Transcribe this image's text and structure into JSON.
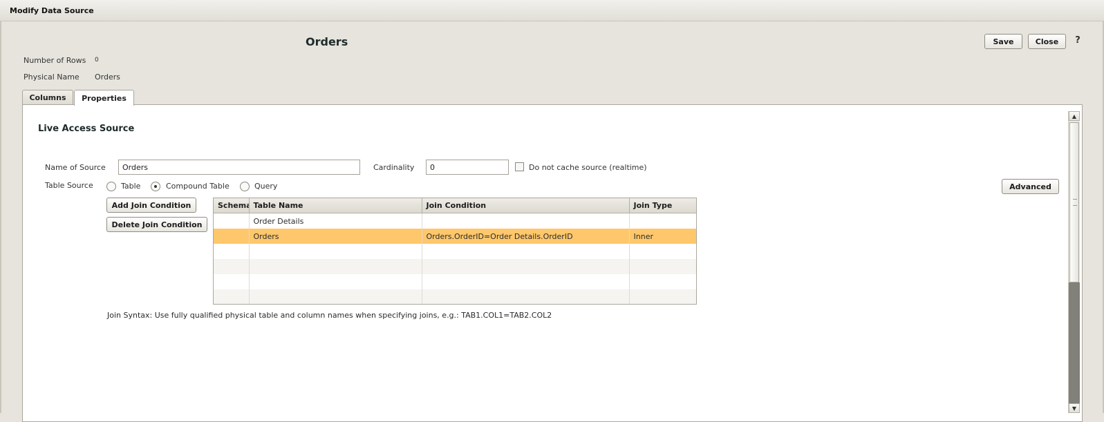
{
  "window": {
    "title": "Modify Data Source"
  },
  "header": {
    "title": "Orders",
    "save_label": "Save",
    "close_label": "Close",
    "help_label": "?"
  },
  "info": {
    "rows_label": "Number of Rows",
    "rows_value": "0",
    "physical_label": "Physical Name",
    "physical_value": "Orders"
  },
  "tabs": [
    {
      "label": "Columns",
      "active": false
    },
    {
      "label": "Properties",
      "active": true
    }
  ],
  "section": {
    "title": "Live Access Source"
  },
  "form": {
    "name_label": "Name of Source",
    "name_value": "Orders",
    "cardinality_label": "Cardinality",
    "cardinality_value": "0",
    "nocache_label": "Do not cache source (realtime)",
    "source_label": "Table Source",
    "source_options": [
      "Table",
      "Compound Table",
      "Query"
    ],
    "source_selected": "Compound Table",
    "advanced_label": "Advanced",
    "add_join_label": "Add Join Condition",
    "delete_join_label": "Delete Join Condition"
  },
  "grid": {
    "columns": [
      "Schema",
      "Table Name",
      "Join Condition",
      "Join Type"
    ],
    "rows": [
      [
        "",
        "Order Details",
        "",
        ""
      ],
      [
        "",
        "Orders",
        "Orders.OrderID=Order Details.OrderID",
        "Inner"
      ],
      [
        "",
        "",
        "",
        ""
      ],
      [
        "",
        "",
        "",
        ""
      ],
      [
        "",
        "",
        "",
        ""
      ],
      [
        "",
        "",
        "",
        ""
      ]
    ],
    "selected_row": 1
  },
  "syntax_note": "Join Syntax: Use fully qualified physical table and column names when specifying joins, e.g.: TAB1.COL1=TAB2.COL2",
  "colors": {
    "selection": "#ffc76b",
    "background": "#e6e4dc"
  }
}
